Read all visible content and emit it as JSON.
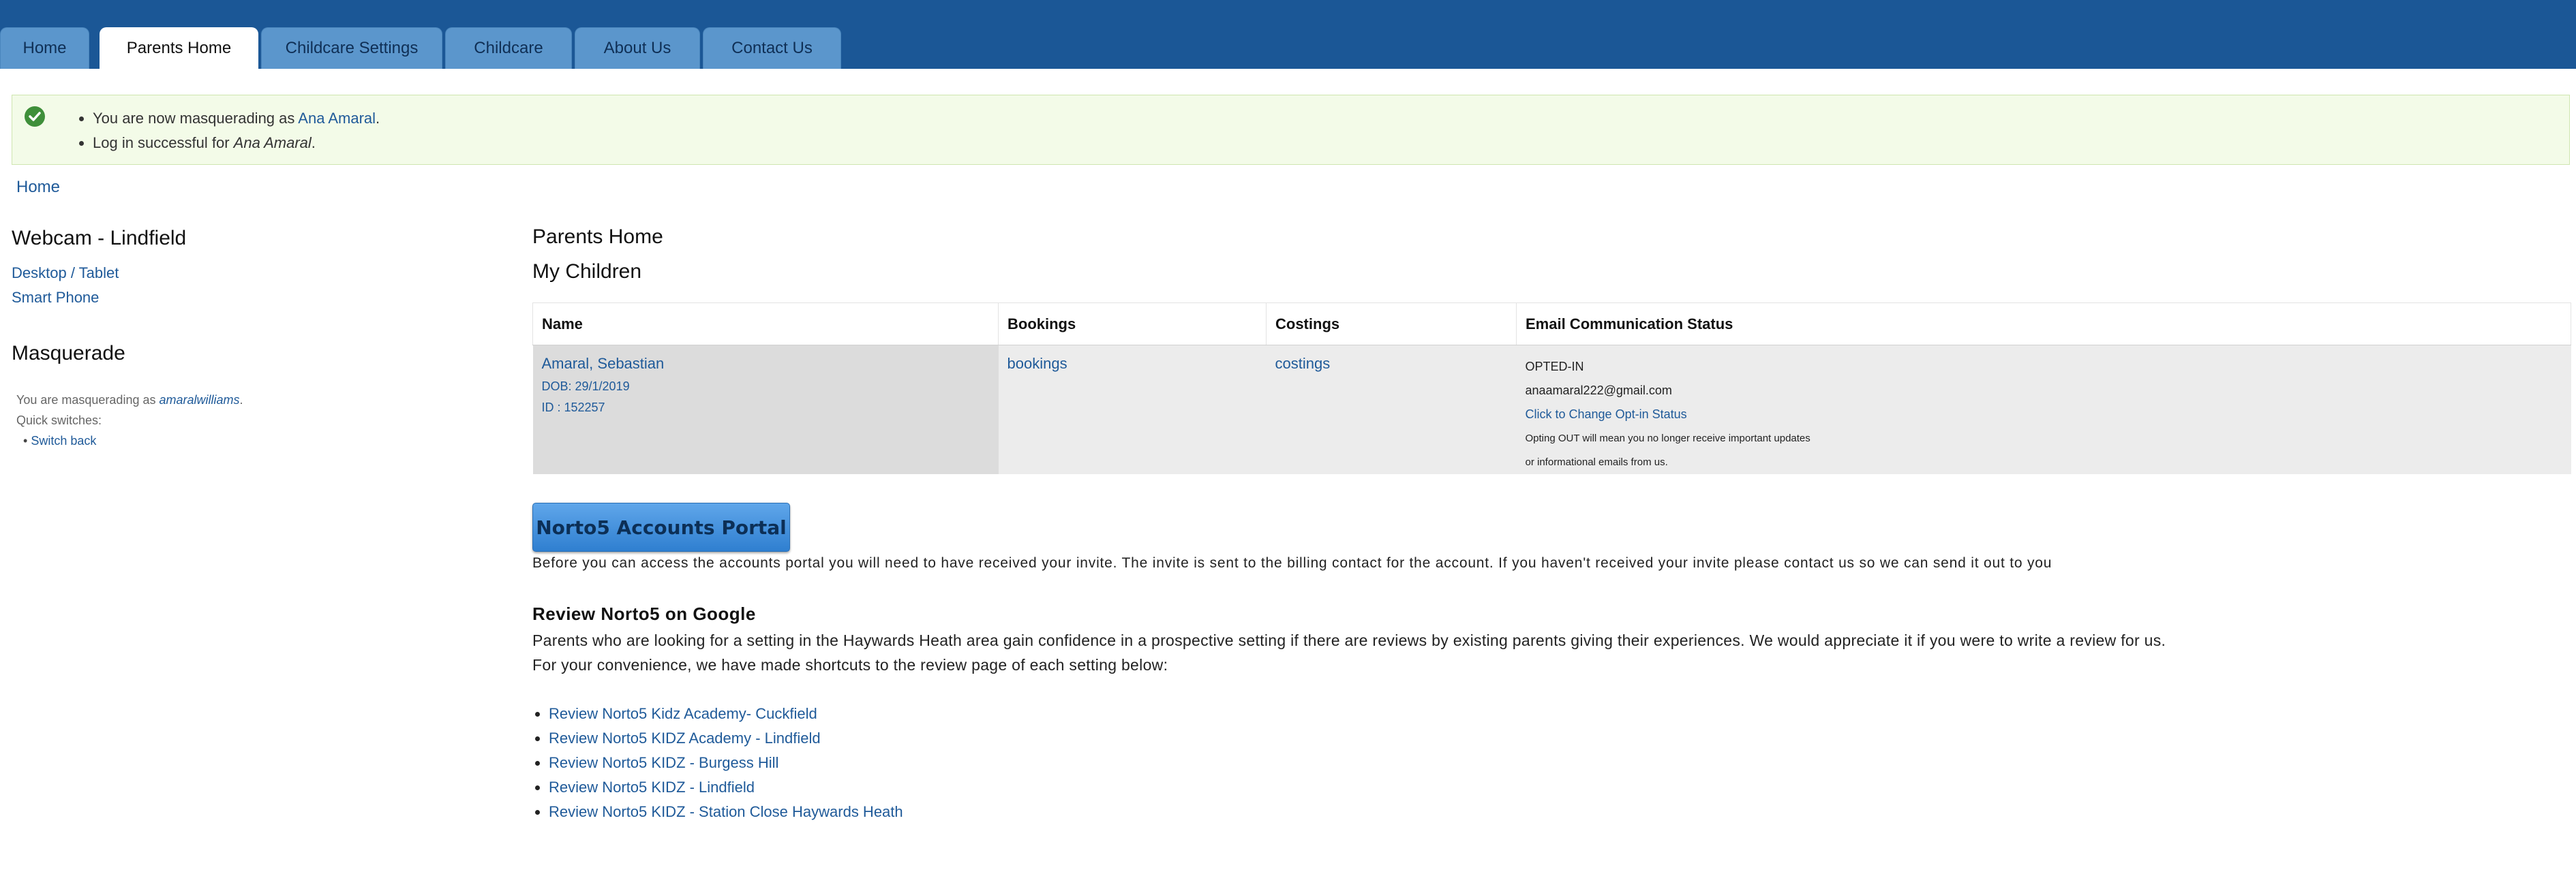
{
  "nav": {
    "tabs": [
      "Home",
      "Parents Home",
      "Childcare Settings",
      "Childcare",
      "About Us",
      "Contact Us"
    ],
    "active_tab": "Parents Home"
  },
  "messages": {
    "line1_prefix": "You are now masquerading as ",
    "line1_link": "Ana Amaral",
    "line1_suffix": ".",
    "line2_prefix": "Log in successful for ",
    "line2_name": "Ana Amaral",
    "line2_suffix": "."
  },
  "breadcrumb": {
    "home": "Home"
  },
  "sidebar": {
    "webcam_title": "Webcam - Lindfield",
    "webcam_links": [
      "Desktop / Tablet",
      "Smart Phone"
    ],
    "masquerade_title": "Masquerade",
    "masquerading_prefix": "You are masquerading as ",
    "masquerading_user": "amaralwilliams",
    "masquerading_suffix": ".",
    "quick_switches": "Quick switches:",
    "switch_back": "Switch back"
  },
  "main": {
    "page_title": "Parents Home",
    "children_title": "My Children",
    "table": {
      "headers": [
        "Name",
        "Bookings",
        "Costings",
        "Email Communication Status"
      ],
      "rows": [
        {
          "name": "Amaral, Sebastian",
          "dob": "DOB: 29/1/2019",
          "id": "ID : 152257",
          "bookings": "bookings",
          "costings": "costings",
          "email_status": "OPTED-IN",
          "email": "anaamaral222@gmail.com",
          "change_link": "Click to Change Opt-in Status",
          "note1": "Opting OUT will mean you no longer receive important updates",
          "note2": "or informational emails from us."
        }
      ]
    },
    "portal_button": "Norto5 Accounts Portal",
    "portal_text": "Before you can access the accounts portal you will need to have received your invite. The invite is sent to the billing contact for the account. If you haven't received your invite please contact us so we can send it out to you",
    "review_title": "Review Norto5 on Google",
    "review_text1": "Parents who are looking for a setting in the Haywards Heath area gain confidence in a prospective setting if there are reviews by existing parents giving their experiences. We would appreciate it if you were to write a review for us.",
    "review_text2": "For your convenience, we have made shortcuts to the review page of each setting below:",
    "review_links": [
      "Review Norto5 Kidz Academy- Cuckfield",
      "Review Norto5 KIDZ Academy - Lindfield",
      "Review Norto5 KIDZ - Burgess Hill",
      "Review Norto5 KIDZ - Lindfield",
      "Review Norto5 KIDZ - Station Close Haywards Heath"
    ]
  },
  "colors": {
    "topbar": "#1b5796",
    "tab": "#5b96cc",
    "link": "#1f5a99",
    "success_bg": "#f3fbe8"
  },
  "icons": {
    "status": "check-circle-icon"
  }
}
